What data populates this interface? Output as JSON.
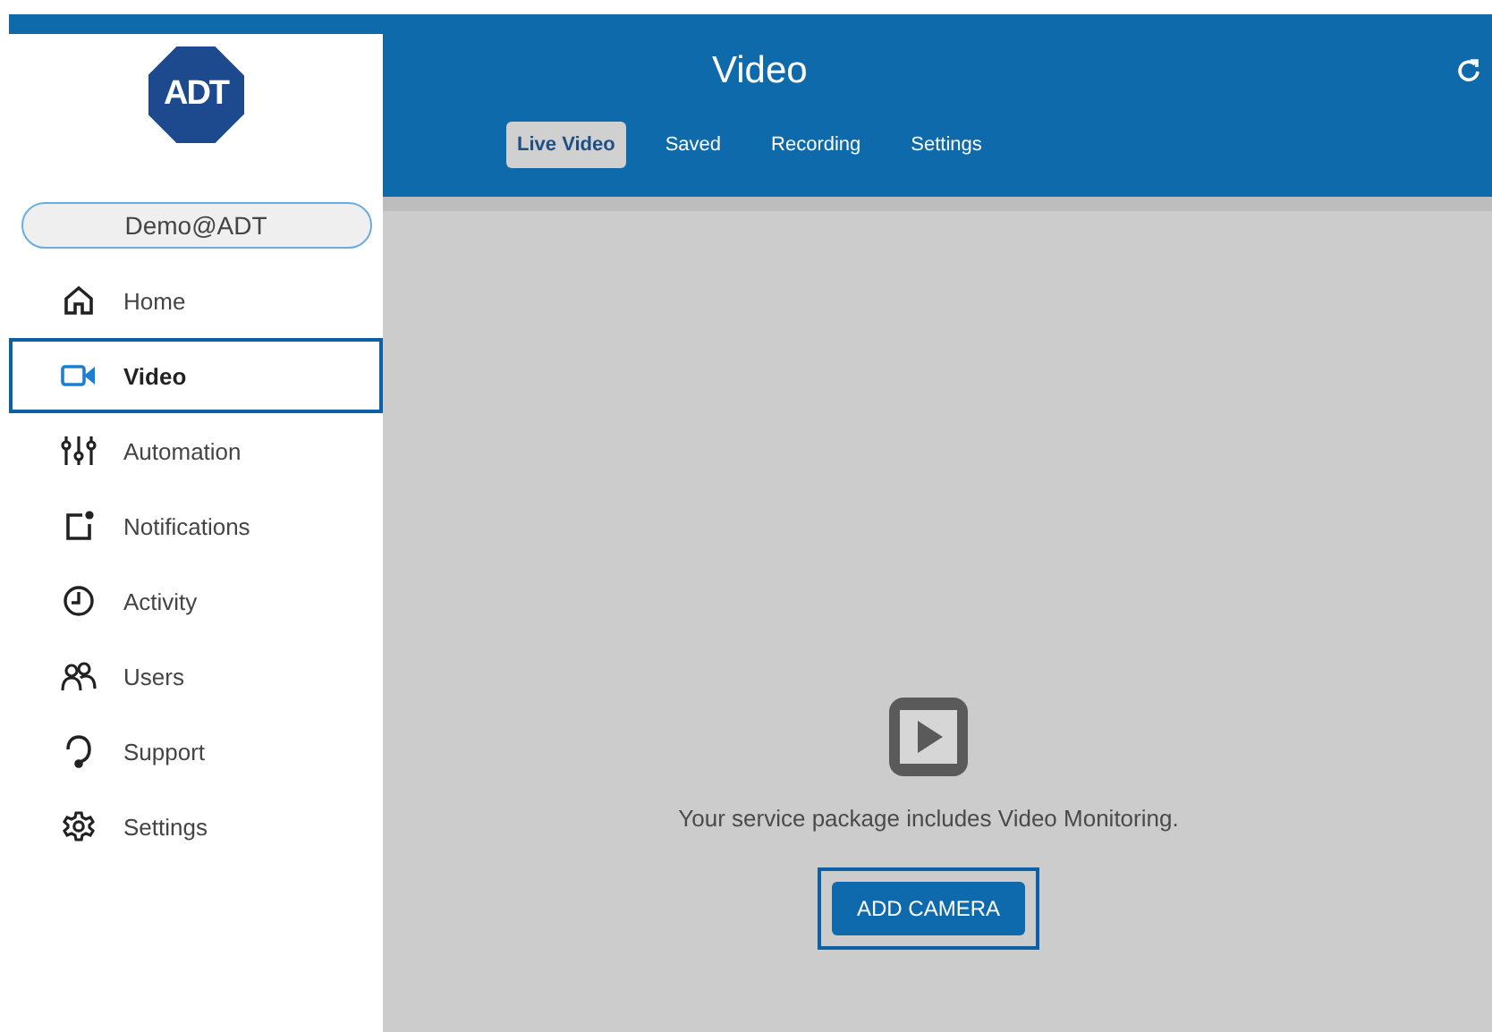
{
  "sidebar": {
    "logo": "ADT",
    "account": "Demo@ADT",
    "items": [
      {
        "label": "Home",
        "selected": false
      },
      {
        "label": "Video",
        "selected": true
      },
      {
        "label": "Automation",
        "selected": false
      },
      {
        "label": "Notifications",
        "selected": false
      },
      {
        "label": "Activity",
        "selected": false
      },
      {
        "label": "Users",
        "selected": false
      },
      {
        "label": "Support",
        "selected": false
      },
      {
        "label": "Settings",
        "selected": false
      }
    ]
  },
  "header": {
    "title": "Video",
    "tabs": [
      {
        "label": "Live Video",
        "selected": true
      },
      {
        "label": "Saved",
        "selected": false
      },
      {
        "label": "Recording",
        "selected": false
      },
      {
        "label": "Settings",
        "selected": false
      }
    ]
  },
  "content": {
    "message": "Your service package includes Video Monitoring.",
    "button": "ADD CAMERA"
  }
}
